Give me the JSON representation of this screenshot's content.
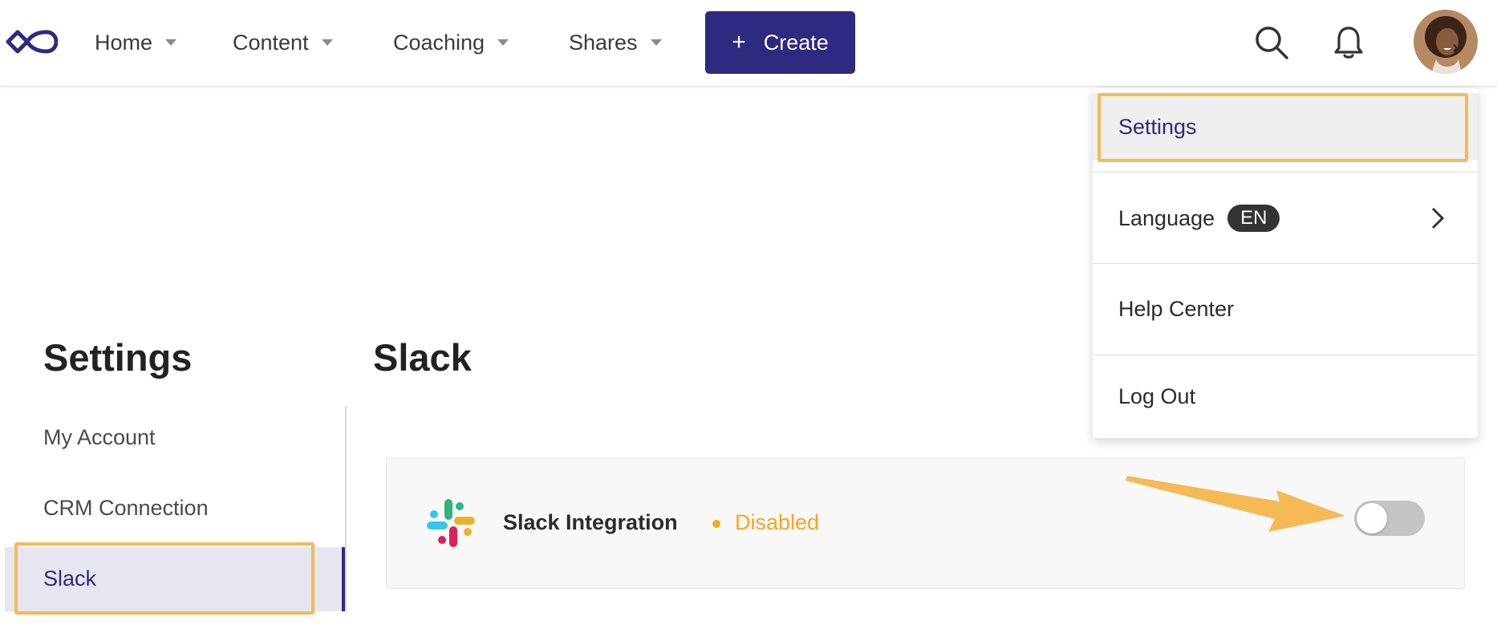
{
  "nav": {
    "items": [
      {
        "label": "Home"
      },
      {
        "label": "Content"
      },
      {
        "label": "Coaching"
      },
      {
        "label": "Shares"
      }
    ],
    "create_label": "Create",
    "create_icon": "plus-icon"
  },
  "colors": {
    "brand": "#2d2a80",
    "highlight": "#f5b955",
    "status_disabled": "#f5a623"
  },
  "sidebar": {
    "title": "Settings",
    "items": [
      {
        "label": "My Account"
      },
      {
        "label": "CRM Connection"
      },
      {
        "label": "Slack",
        "active": true
      }
    ]
  },
  "main": {
    "title": "Slack",
    "integration": {
      "name": "Slack Integration",
      "status": "Disabled",
      "enabled": false
    }
  },
  "menu": {
    "settings": "Settings",
    "language": "Language",
    "language_badge": "EN",
    "help": "Help Center",
    "logout": "Log Out"
  }
}
